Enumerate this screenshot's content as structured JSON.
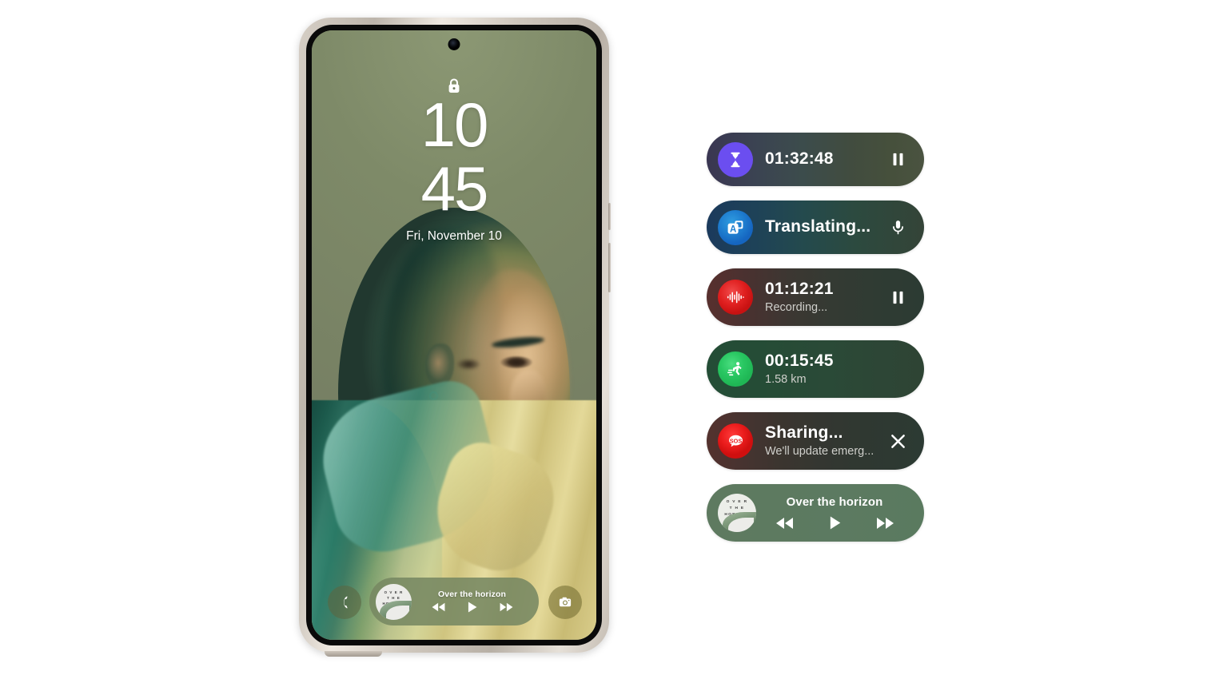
{
  "phone": {
    "lock_icon": "lock-icon",
    "camera_punch": "front-camera-icon",
    "clock": {
      "hours": "10",
      "minutes": "45",
      "date": "Fri, November 10"
    },
    "shortcuts": {
      "call": "phone-icon",
      "camera": "camera-icon"
    },
    "media_widget": {
      "title": "Over the horizon",
      "album_art_lines": [
        "O V E R",
        "T H E",
        "HORIZON"
      ],
      "controls": [
        "previous",
        "play",
        "next"
      ]
    }
  },
  "live_activities": [
    {
      "id": "timer",
      "icon": "hourglass-icon",
      "primary": "01:32:48",
      "sub": "",
      "action": "pause-button",
      "accent": "#6b4ef0"
    },
    {
      "id": "translate",
      "icon": "translate-icon",
      "primary": "Translating...",
      "sub": "",
      "action": "microphone-button",
      "accent": "#1f7fd0"
    },
    {
      "id": "recorder",
      "icon": "waveform-icon",
      "primary": "01:12:21",
      "sub": "Recording...",
      "action": "pause-button",
      "accent": "#e02020"
    },
    {
      "id": "workout",
      "icon": "running-icon",
      "primary": "00:15:45",
      "sub": "1.58 km",
      "action": "",
      "accent": "#29c762"
    },
    {
      "id": "sos",
      "icon": "sos-icon",
      "primary": "Sharing...",
      "sub": "We'll update emerg...",
      "action": "close-button",
      "accent": "#ea1c1c"
    },
    {
      "id": "music",
      "icon": "album-art",
      "primary": "Over the horizon",
      "sub": "",
      "action": "",
      "accent": "#5d7a60",
      "album_art_lines": [
        "O V E R",
        "T H E",
        "HORIZON"
      ],
      "controls": [
        "previous",
        "play",
        "next"
      ]
    }
  ]
}
